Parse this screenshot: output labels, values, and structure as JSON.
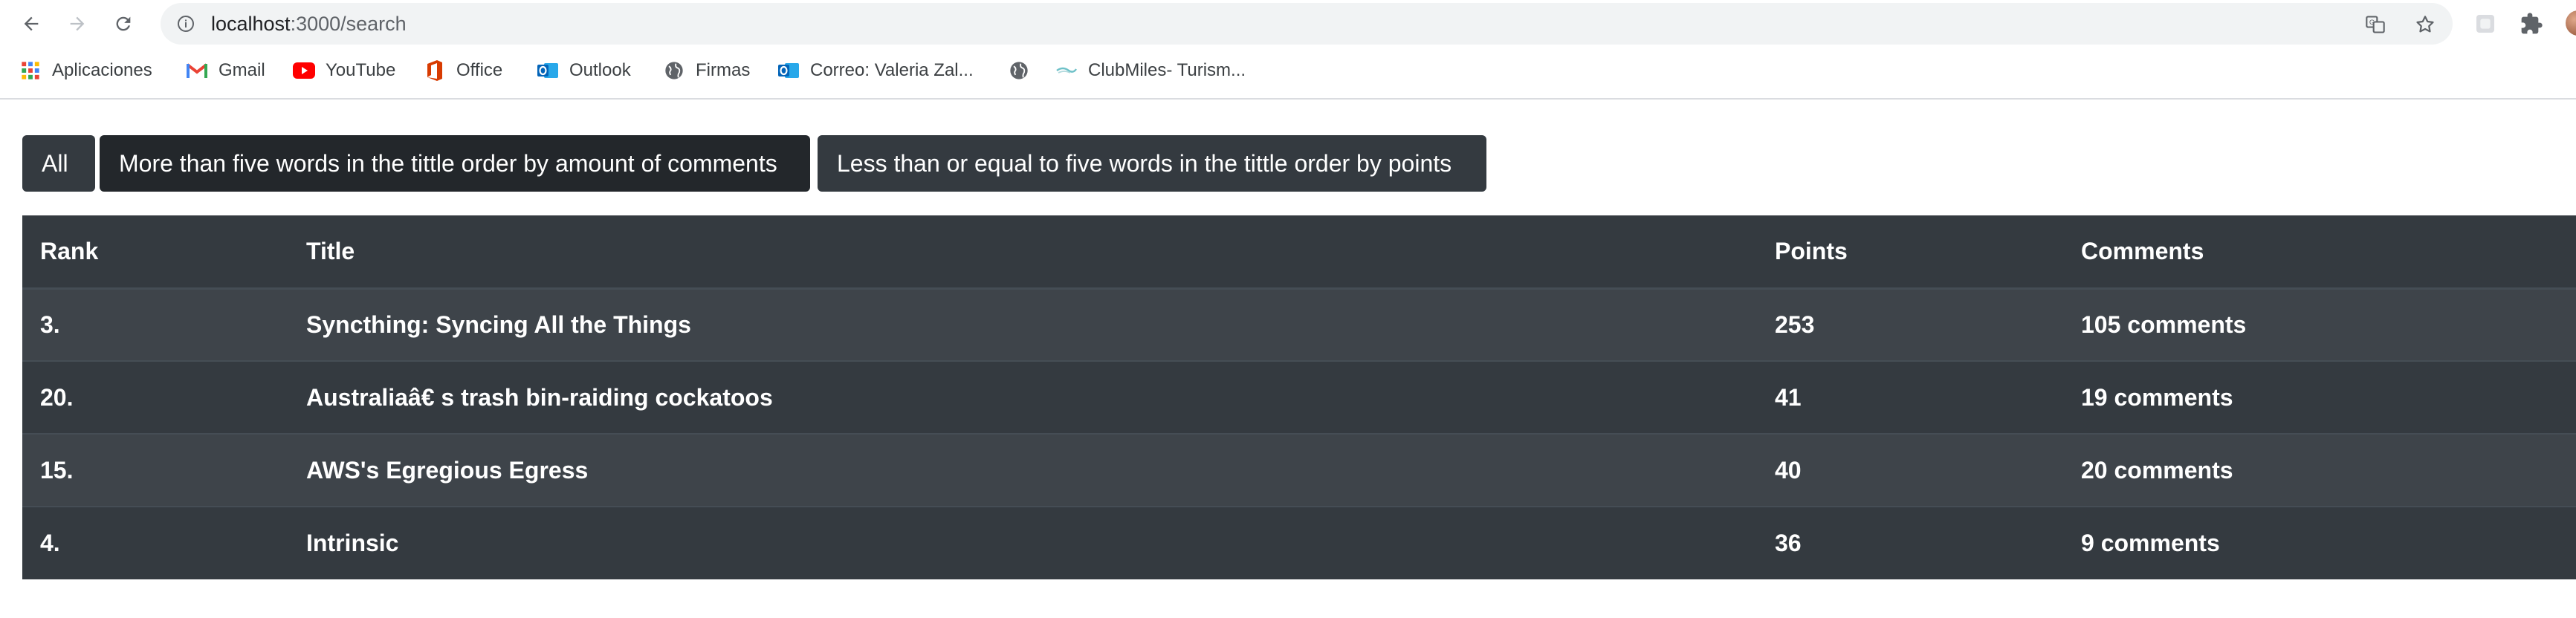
{
  "browser": {
    "url_host": "localhost",
    "url_path": ":3000/search"
  },
  "bookmarks": [
    {
      "label": "Aplicaciones",
      "icon": "apps-grid-icon"
    },
    {
      "label": "Gmail",
      "icon": "gmail-icon"
    },
    {
      "label": "YouTube",
      "icon": "youtube-icon"
    },
    {
      "label": "Office",
      "icon": "office-icon"
    },
    {
      "label": "Outlook",
      "icon": "outlook-icon"
    },
    {
      "label": "Firmas",
      "icon": "globe-icon"
    },
    {
      "label": "Correo: Valeria Zal...",
      "icon": "outlook-icon"
    },
    {
      "label": "",
      "icon": "globe-icon"
    },
    {
      "label": "ClubMiles- Turism...",
      "icon": "clubmiles-icon"
    }
  ],
  "filters": {
    "all": "All",
    "more_than_five": "More than five words in the tittle order by amount of comments",
    "less_or_equal_five": "Less than or equal to five words in the tittle order by points"
  },
  "table": {
    "headers": {
      "rank": "Rank",
      "title": "Title",
      "points": "Points",
      "comments": "Comments"
    },
    "rows": [
      {
        "rank": "3.",
        "title": "Syncthing: Syncing All the Things",
        "points": "253",
        "comments": "105 comments"
      },
      {
        "rank": "20.",
        "title": "Australiaâ€   s trash bin-raiding cockatoos",
        "points": "41",
        "comments": "19 comments"
      },
      {
        "rank": "15.",
        "title": "AWS's Egregious Egress",
        "points": "40",
        "comments": "20 comments"
      },
      {
        "rank": "4.",
        "title": "Intrinsic",
        "points": "36",
        "comments": "9 comments"
      }
    ]
  },
  "colors": {
    "button_bg": "#343a40",
    "table_dark": "#343a40",
    "table_stripe": "#3e444a"
  }
}
